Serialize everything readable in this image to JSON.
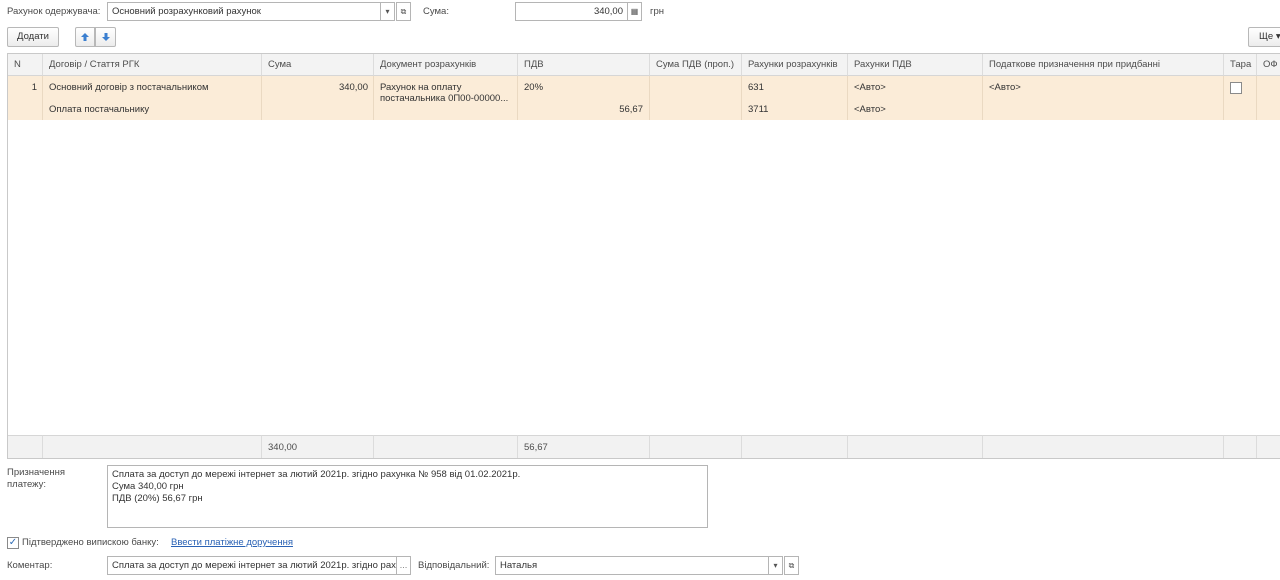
{
  "top": {
    "account_label": "Рахунок одержувача:",
    "account_value": "Основний розрахунковий рахунок",
    "sum_label": "Сума:",
    "sum_value": "340,00",
    "currency": "грн"
  },
  "toolbar": {
    "add_label": "Додати",
    "more_label": "Ще"
  },
  "table": {
    "columns": [
      "N",
      "Договір / Стаття РГК",
      "Сума",
      "Документ розрахунків",
      "ПДВ",
      "Сума ПДВ (проп.)",
      "Рахунки розрахунків",
      "Рахунки ПДВ",
      "Податкове призначення при придбанні",
      "Тара",
      "ОФ"
    ],
    "row1": {
      "n": "1",
      "contract": "Основний договір з постачальником",
      "article": "Оплата постачальнику",
      "sum": "340,00",
      "doc_line1": "Рахунок на оплату",
      "doc_line2": "постачальника 0П00-00000...",
      "vat_rate": "20%",
      "vat_sum": "56,67",
      "acc1": "631",
      "acc2": "3711",
      "vat_acc1": "<Авто>",
      "vat_acc2": "<Авто>",
      "tax_purpose": "<Авто>"
    },
    "footer": {
      "sum_total": "340,00",
      "vat_total": "56,67"
    }
  },
  "purpose": {
    "label_line1": "Призначення",
    "label_line2": "платежу:",
    "line1": "Сплата за доступ до мережі інтернет за лютий 2021р. згідно рахунка № 958 від 01.02.2021р.",
    "line2": "Сума 340,00 грн",
    "line3": "ПДВ (20%) 56,67 грн"
  },
  "confirm": {
    "label": "Підтверджено випискою банку:",
    "link": "Ввести платіжне доручення",
    "checked": true
  },
  "bottom": {
    "comment_label": "Коментар:",
    "comment_value": "Сплата за доступ до мережі інтернет за лютий 2021р. згідно рах",
    "responsible_label": "Відповідальний:",
    "responsible_value": "Наталья"
  }
}
